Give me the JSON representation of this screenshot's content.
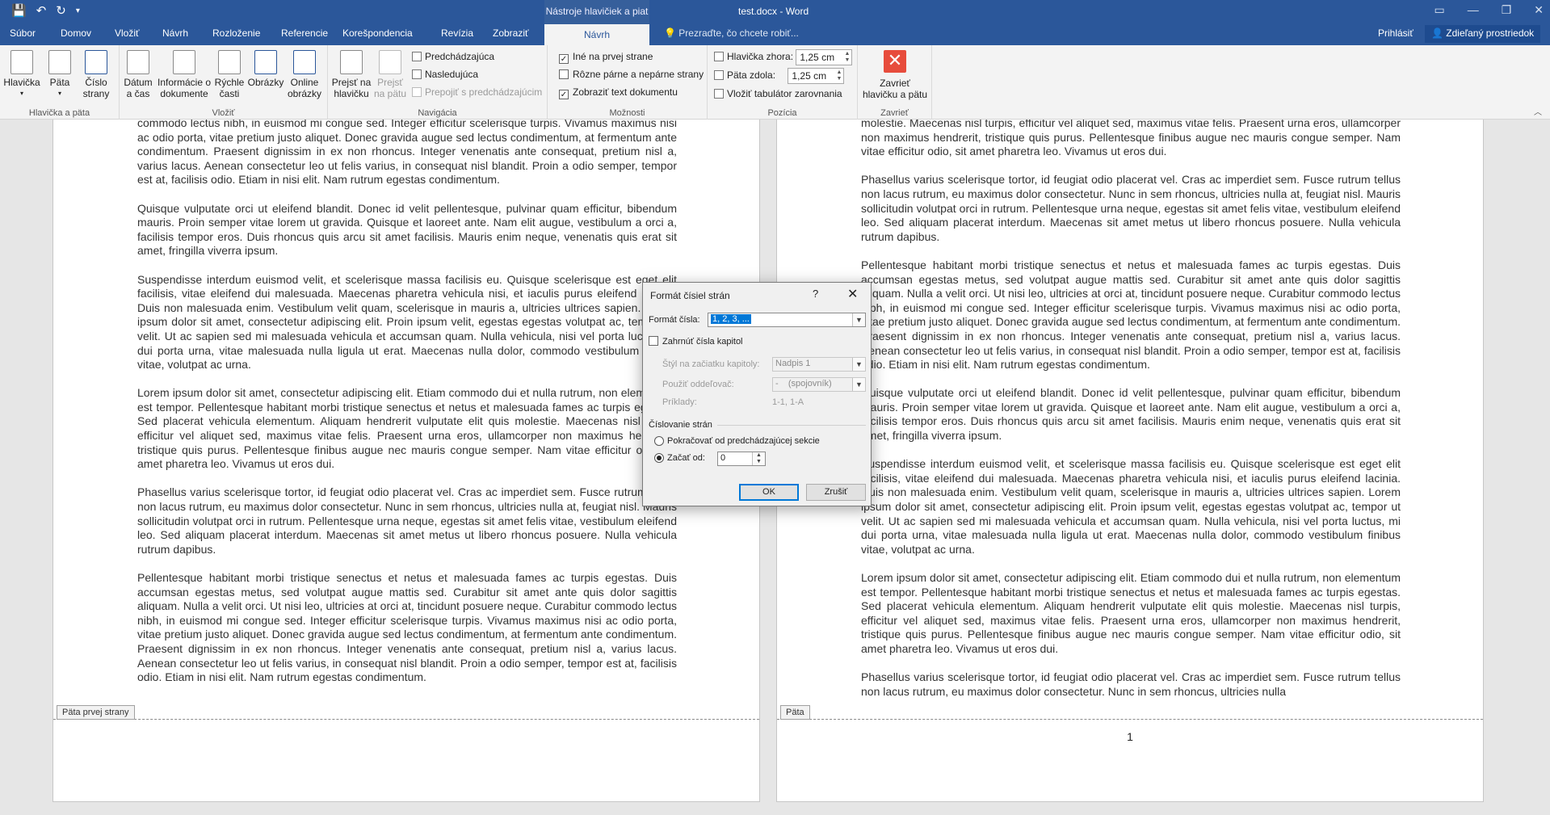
{
  "titlebar": {
    "context_tools": "Nástroje hlavičiek a piat",
    "document_title": "test.docx - Word"
  },
  "tabs": {
    "subor": "Súbor",
    "domov": "Domov",
    "vlozit": "Vložiť",
    "navrh": "Návrh",
    "rozlozenie": "Rozloženie",
    "referencie": "Referencie",
    "korespondencia": "Korešpondencia",
    "revizia": "Revízia",
    "zobrazit": "Zobraziť",
    "navrh_context": "Návrh",
    "tell_me": "Prezraďte, čo chcete robiť...",
    "signin": "Prihlásiť",
    "share": "Zdieľaný prostriedok"
  },
  "ribbon": {
    "g1": {
      "label": "Hlavička a päta",
      "header": "Hlavička",
      "footer": "Päta",
      "page_number_1": "Číslo",
      "page_number_2": "strany"
    },
    "g2": {
      "label": "Vložiť",
      "datetime_1": "Dátum",
      "datetime_2": "a čas",
      "docinfo_1": "Informácie o",
      "docinfo_2": "dokumente",
      "quickparts_1": "Rýchle",
      "quickparts_2": "časti",
      "pictures": "Obrázky",
      "online_1": "Online",
      "online_2": "obrázky"
    },
    "g3": {
      "label": "Navigácia",
      "goto_header_1": "Prejsť na",
      "goto_header_2": "hlavičku",
      "goto_footer_1": "Prejsť",
      "goto_footer_2": "na pätu",
      "previous": "Predchádzajúca",
      "next": "Nasledujúca",
      "link_prev": "Prepojiť s predchádzajúcim"
    },
    "g4": {
      "label": "Možnosti",
      "diff_first": "Iné na prvej strane",
      "diff_odd_even": "Rôzne párne a nepárne strany",
      "show_doc_text": "Zobraziť text dokumentu"
    },
    "g5": {
      "label": "Pozícia",
      "header_top": "Hlavička zhora:",
      "header_top_value": "1,25 cm",
      "footer_bottom": "Päta zdola:",
      "footer_bottom_value": "1,25 cm",
      "align_tab": "Vložiť tabulátor zarovnania"
    },
    "g6": {
      "label": "Zavrieť",
      "close_1": "Zavrieť",
      "close_2": "hlavičku a pätu"
    }
  },
  "pages": {
    "left": {
      "paragraphs": [
        "commodo lectus nibh, in euismod mi congue sed. Integer efficitur scelerisque turpis. Vivamus maximus nisi ac odio porta, vitae pretium justo aliquet. Donec gravida augue sed lectus condimentum, at fermentum ante condimentum. Praesent dignissim in ex non rhoncus. Integer venenatis ante consequat, pretium nisl a, varius lacus. Aenean consectetur leo ut felis varius, in consequat nisl blandit. Proin a odio semper, tempor est at, facilisis odio. Etiam in nisi elit. Nam rutrum egestas condimentum.",
        "Quisque vulputate orci ut eleifend blandit. Donec id velit pellentesque, pulvinar quam efficitur, bibendum mauris. Proin semper vitae lorem ut gravida. Quisque et laoreet ante. Nam elit augue, vestibulum a orci a, facilisis tempor eros. Duis rhoncus quis arcu sit amet facilisis. Mauris enim neque, venenatis quis erat sit amet, fringilla viverra ipsum.",
        "Suspendisse interdum euismod velit, et scelerisque massa facilisis eu. Quisque scelerisque est eget elit facilisis, vitae eleifend dui malesuada. Maecenas pharetra vehicula nisi, et iaculis purus eleifend lacinia. Duis non malesuada enim. Vestibulum velit quam, scelerisque in mauris a, ultricies ultrices sapien. Lorem ipsum dolor sit amet, consectetur adipiscing elit. Proin ipsum velit, egestas egestas volutpat ac, tempor ut velit. Ut ac sapien sed mi malesuada vehicula et accumsan quam. Nulla vehicula, nisi vel porta luctus, mi dui porta urna, vitae malesuada nulla ligula ut erat. Maecenas nulla dolor, commodo vestibulum finibus vitae, volutpat ac urna.",
        "Lorem ipsum dolor sit amet, consectetur adipiscing elit. Etiam commodo dui et nulla rutrum, non elementum est tempor. Pellentesque habitant morbi tristique senectus et netus et malesuada fames ac turpis egestas. Sed placerat vehicula elementum. Aliquam hendrerit vulputate elit quis molestie. Maecenas nisl turpis, efficitur vel aliquet sed, maximus vitae felis. Praesent urna eros, ullamcorper non maximus hendrerit, tristique quis purus. Pellentesque finibus augue nec mauris congue semper. Nam vitae efficitur odio, sit amet pharetra leo. Vivamus ut eros dui.",
        "Phasellus varius scelerisque tortor, id feugiat odio placerat vel. Cras ac imperdiet sem. Fusce rutrum tellus non lacus rutrum, eu maximus dolor consectetur. Nunc in sem rhoncus, ultricies nulla at, feugiat nisl. Mauris sollicitudin volutpat orci in rutrum. Pellentesque urna neque, egestas sit amet felis vitae, vestibulum eleifend leo. Sed aliquam placerat interdum. Maecenas sit amet metus ut libero rhoncus posuere. Nulla vehicula rutrum dapibus.",
        "Pellentesque habitant morbi tristique senectus et netus et malesuada fames ac turpis egestas. Duis accumsan egestas metus, sed volutpat augue mattis sed. Curabitur sit amet ante quis dolor sagittis aliquam. Nulla a velit orci. Ut nisi leo, ultricies at orci at, tincidunt posuere neque. Curabitur commodo lectus nibh, in euismod mi congue sed. Integer efficitur scelerisque turpis. Vivamus maximus nisi ac odio porta, vitae pretium justo aliquet. Donec gravida augue sed lectus condimentum, at fermentum ante condimentum. Praesent dignissim in ex non rhoncus. Integer venenatis ante consequat, pretium nisl a, varius lacus. Aenean consectetur leo ut felis varius, in consequat nisl blandit. Proin a odio semper, tempor est at, facilisis odio. Etiam in nisi elit. Nam rutrum egestas condimentum."
      ],
      "footer_tag": "Päta prvej strany"
    },
    "right": {
      "paragraphs": [
        "molestie. Maecenas nisl turpis, efficitur vel aliquet sed, maximus vitae felis. Praesent urna eros, ullamcorper non maximus hendrerit, tristique quis purus. Pellentesque finibus augue nec mauris congue semper. Nam vitae efficitur odio, sit amet pharetra leo. Vivamus ut eros dui.",
        "Phasellus varius scelerisque tortor, id feugiat odio placerat vel. Cras ac imperdiet sem. Fusce rutrum tellus non lacus rutrum, eu maximus dolor consectetur. Nunc in sem rhoncus, ultricies nulla at, feugiat nisl. Mauris sollicitudin volutpat orci in rutrum. Pellentesque urna neque, egestas sit amet felis vitae, vestibulum eleifend leo. Sed aliquam placerat interdum. Maecenas sit amet metus ut libero rhoncus posuere. Nulla vehicula rutrum dapibus.",
        "Pellentesque habitant morbi tristique senectus et netus et malesuada fames ac turpis egestas. Duis accumsan egestas metus, sed volutpat augue mattis sed. Curabitur sit amet ante quis dolor sagittis aliquam. Nulla a velit orci. Ut nisi leo, ultricies at orci at, tincidunt posuere neque. Curabitur commodo lectus nibh, in euismod mi congue sed. Integer efficitur scelerisque turpis. Vivamus maximus nisi ac odio porta, vitae pretium justo aliquet. Donec gravida augue sed lectus condimentum, at fermentum ante condimentum. Praesent dignissim in ex non rhoncus. Integer venenatis ante consequat, pretium nisl a, varius lacus. Aenean consectetur leo ut felis varius, in consequat nisl blandit. Proin a odio semper, tempor est at, facilisis odio. Etiam in nisi elit. Nam rutrum egestas condimentum.",
        "Quisque vulputate orci ut eleifend blandit. Donec id velit pellentesque, pulvinar quam efficitur, bibendum mauris. Proin semper vitae lorem ut gravida. Quisque et laoreet ante. Nam elit augue, vestibulum a orci a, facilisis tempor eros. Duis rhoncus quis arcu sit amet facilisis. Mauris enim neque, venenatis quis erat sit amet, fringilla viverra ipsum.",
        "Suspendisse interdum euismod velit, et scelerisque massa facilisis eu. Quisque scelerisque est eget elit facilisis, vitae eleifend dui malesuada. Maecenas pharetra vehicula nisi, et iaculis purus eleifend lacinia. Duis non malesuada enim. Vestibulum velit quam, scelerisque in mauris a, ultricies ultrices sapien. Lorem ipsum dolor sit amet, consectetur adipiscing elit. Proin ipsum velit, egestas egestas volutpat ac, tempor ut velit. Ut ac sapien sed mi malesuada vehicula et accumsan quam. Nulla vehicula, nisi vel porta luctus, mi dui porta urna, vitae malesuada nulla ligula ut erat. Maecenas nulla dolor, commodo vestibulum finibus vitae, volutpat ac urna.",
        "Lorem ipsum dolor sit amet, consectetur adipiscing elit. Etiam commodo dui et nulla rutrum, non elementum est tempor. Pellentesque habitant morbi tristique senectus et netus et malesuada fames ac turpis egestas. Sed placerat vehicula elementum. Aliquam hendrerit vulputate elit quis molestie. Maecenas nisl turpis, efficitur vel aliquet sed, maximus vitae felis. Praesent urna eros, ullamcorper non maximus hendrerit, tristique quis purus. Pellentesque finibus augue nec mauris congue semper. Nam vitae efficitur odio, sit amet pharetra leo. Vivamus ut eros dui.",
        "Phasellus varius scelerisque tortor, id feugiat odio placerat vel. Cras ac imperdiet sem. Fusce rutrum tellus non lacus rutrum, eu maximus dolor consectetur. Nunc in sem rhoncus, ultricies nulla"
      ],
      "footer_tag": "Päta",
      "page_number": "1"
    }
  },
  "dialog": {
    "title": "Formát čísiel strán",
    "help": "?",
    "close": "✕",
    "number_format_label": "Formát čísla:",
    "number_format_value": "1, 2, 3, ...",
    "include_chapter": "Zahrnúť čísla kapitol",
    "chapter_style_label": "Štýl na začiatku kapitoly:",
    "chapter_style_value": "Nadpis 1",
    "separator_label": "Použiť oddeľovač:",
    "separator_value": "-    (spojovník)",
    "examples_label": "Príklady:",
    "examples_value": "1-1, 1-A",
    "numbering_section": "Číslovanie strán",
    "continue_prev": "Pokračovať od predchádzajúcej sekcie",
    "start_at": "Začať od:",
    "start_at_value": "0",
    "ok": "OK",
    "cancel": "Zrušiť"
  },
  "icons": {
    "save": "save-icon",
    "undo": "undo-icon",
    "redo": "redo-icon",
    "customize": "customize-icon",
    "lightbulb": "lightbulb-icon",
    "person": "person-icon",
    "close_red": "close-icon"
  },
  "colors": {
    "title_bar": "#2b579a",
    "context_tab": "#365f9b",
    "selection": "#0078d7",
    "close_button": "#e74c3c"
  }
}
